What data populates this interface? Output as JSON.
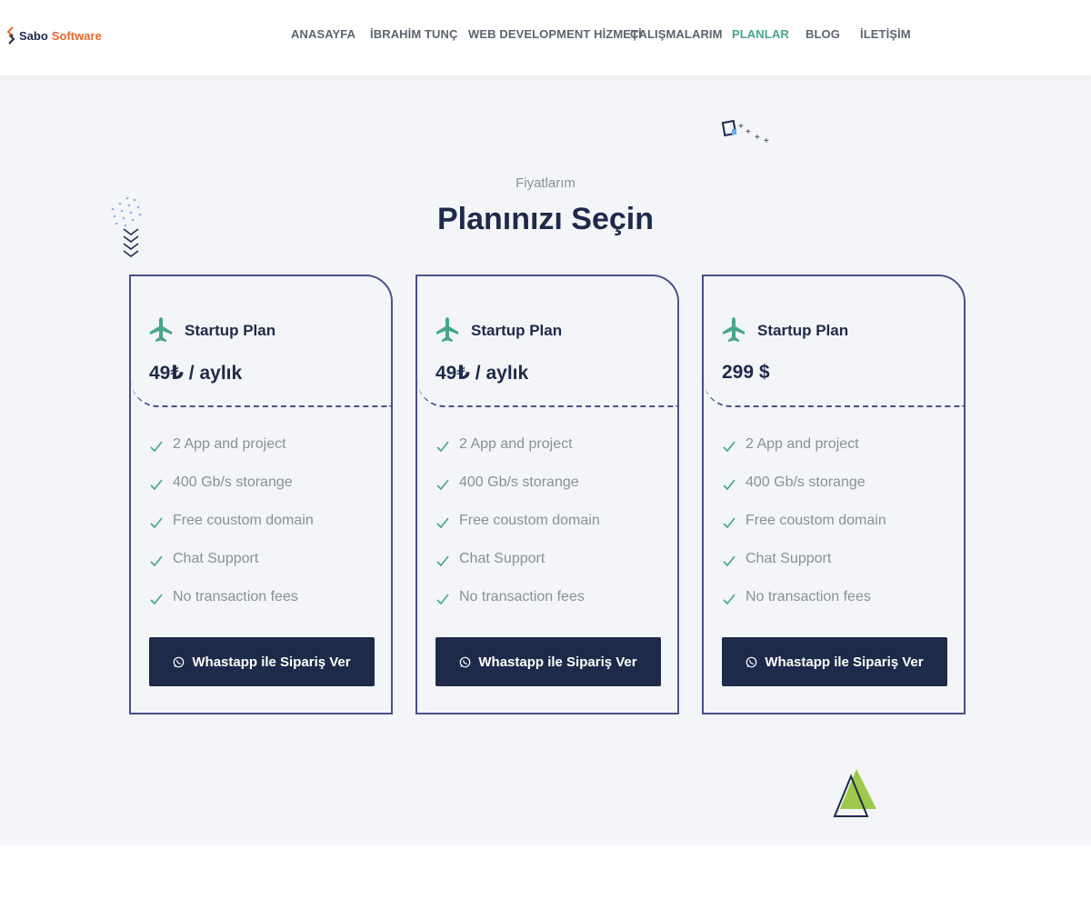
{
  "header": {
    "brand_first": "Sabo",
    "brand_second": "Software",
    "nav": [
      {
        "label": "ANASAYFA",
        "active": false
      },
      {
        "label": "İBRAHİM TUNÇ",
        "active": false
      },
      {
        "label": "WEB DEVELOPMENT HİZMETİ",
        "active": false
      },
      {
        "label": "ÇALIŞMALARIM",
        "active": false
      },
      {
        "label": "PLANLAR",
        "active": true
      },
      {
        "label": "BLOG",
        "active": false
      },
      {
        "label": "İLETİŞİM",
        "active": false
      }
    ]
  },
  "pricing": {
    "subtitle": "Fiyatlarım",
    "title": "Planınızı Seçin",
    "plans": [
      {
        "icon": "plane-icon",
        "name": "Startup Plan",
        "price": "49₺ / aylık",
        "features": [
          "2 App and project",
          "400 Gb/s storange",
          "Free coustom domain",
          "Chat Support",
          "No transaction fees"
        ],
        "button": "Whastapp ile Sipariş Ver"
      },
      {
        "icon": "plane-icon",
        "name": "Startup Plan",
        "price": "49₺ / aylık",
        "features": [
          "2 App and project",
          "400 Gb/s storange",
          "Free coustom domain",
          "Chat Support",
          "No transaction fees"
        ],
        "button": "Whastapp ile Sipariş Ver"
      },
      {
        "icon": "plane-icon",
        "name": "Startup Plan",
        "price": "299 $",
        "features": [
          "2 App and project",
          "400 Gb/s storange",
          "Free coustom domain",
          "Chat Support",
          "No transaction fees"
        ],
        "button": "Whastapp ile Sipariş Ver"
      }
    ]
  },
  "colors": {
    "accent": "#45a58d",
    "navy": "#1e2a4a",
    "brand_orange": "#e8692c",
    "card_border": "#4a4f8a",
    "background": "#f3f5f8"
  }
}
